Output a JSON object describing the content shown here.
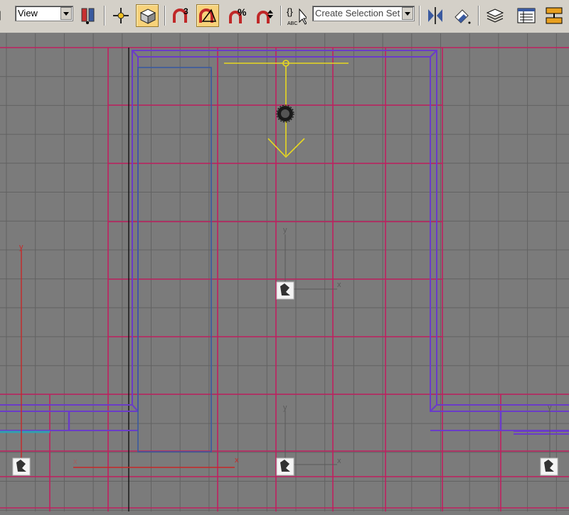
{
  "toolbar": {
    "reference_coord_system": "View",
    "named_selection_placeholder": "Create Selection Set",
    "buttons": [
      {
        "name": "select-filter-icon"
      },
      {
        "name": "use-pivot-center-icon"
      },
      {
        "name": "select-and-manipulate-icon"
      },
      {
        "name": "snaps-toggle-3d-icon",
        "label": "3"
      },
      {
        "name": "angle-snap-icon"
      },
      {
        "name": "percent-snap-icon",
        "label": "%"
      },
      {
        "name": "spinner-snap-icon"
      },
      {
        "name": "edit-named-selection-icon",
        "label": "ABC"
      },
      {
        "name": "mirror-icon"
      },
      {
        "name": "align-icon"
      },
      {
        "name": "layer-manager-icon"
      },
      {
        "name": "curve-editor-icon"
      },
      {
        "name": "schematic-view-icon"
      }
    ]
  },
  "viewport": {
    "axis_labels": {
      "x": "x",
      "y": "y"
    },
    "colors": {
      "background": "#7b7b7b",
      "grid": "#626262",
      "frame_lines": "#c02060",
      "wall_outline": "#6a3cc8",
      "door": "#3a5aa0",
      "light": "#e8d820"
    }
  }
}
